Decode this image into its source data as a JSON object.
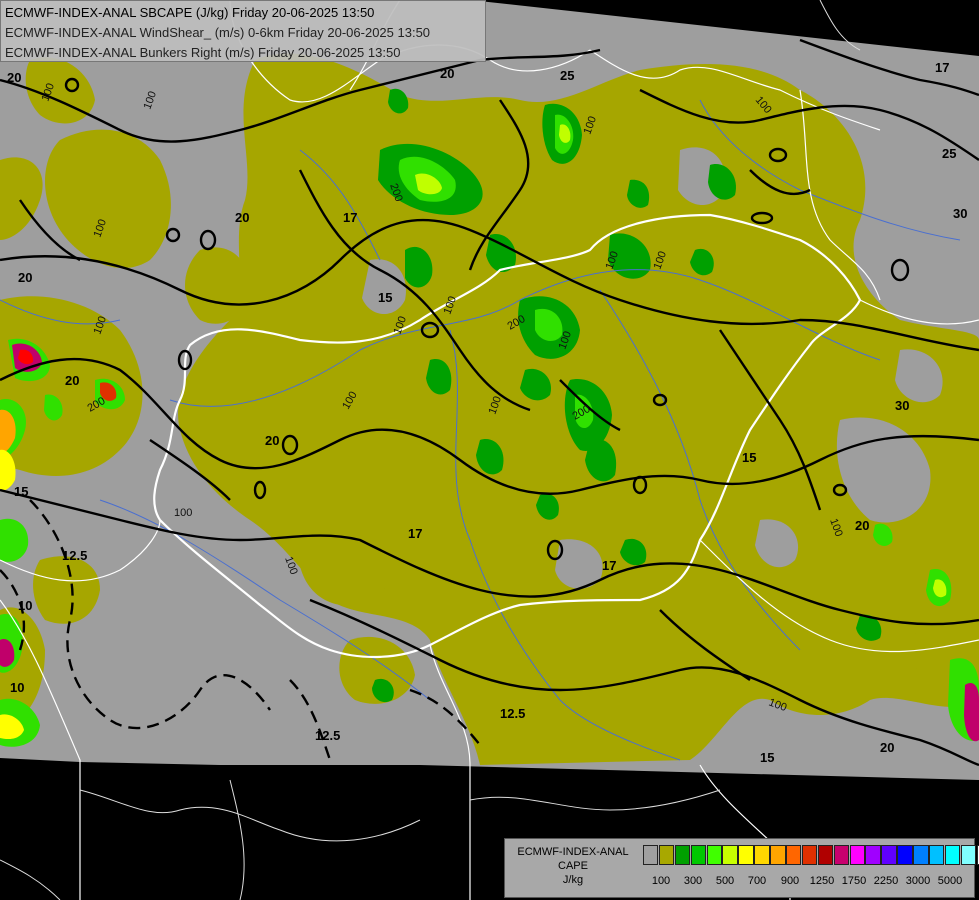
{
  "header": {
    "line1": "ECMWF-INDEX-ANAL SBCAPE (J/kg) Friday 20-06-2025 13:50",
    "line2": "ECMWF-INDEX-ANAL WindShear_ (m/s) 0-6km Friday 20-06-2025 13:50",
    "line3": "ECMWF-INDEX-ANAL Bunkers Right (m/s) Friday 20-06-2025 13:50"
  },
  "legend": {
    "title1": "ECMWF-INDEX-ANAL",
    "title2": "CAPE",
    "title3": "J/kg",
    "colors": [
      "#a0a0a0",
      "#a8a800",
      "#00a000",
      "#00c800",
      "#40ff00",
      "#c8ff00",
      "#ffff00",
      "#ffd700",
      "#ffa500",
      "#ff6600",
      "#e03000",
      "#b00000",
      "#c8006e",
      "#ff00ff",
      "#a000ff",
      "#6000ff",
      "#0000ff",
      "#0080ff",
      "#00c0ff",
      "#00ffff",
      "#80ffff",
      "#ffffff"
    ],
    "ticks": [
      "100",
      "300",
      "500",
      "700",
      "900",
      "1250",
      "1750",
      "2250",
      "3000",
      "5000"
    ]
  },
  "map": {
    "colors": {
      "background": "#000000",
      "no_cape": "#9e9e9e",
      "cape_100": "#a6a600",
      "cape_300": "#00a000",
      "cape_500": "#30e000",
      "cape_high": "#c0ff00",
      "cape_vhigh": "#ff0000",
      "cape_ext": "#c0006a",
      "border": "#ffffff",
      "river": "#4a6fd0",
      "contour": "#000000"
    },
    "contour_labels": [
      "20",
      "25",
      "17",
      "25",
      "30",
      "20",
      "17",
      "15",
      "20",
      "20",
      "15",
      "20",
      "12.5",
      "10",
      "10",
      "12.5",
      "12.5",
      "15",
      "20",
      "15",
      "17",
      "20",
      "30",
      "20",
      "17"
    ],
    "cape_labels": [
      "100",
      "100",
      "100",
      "100",
      "100",
      "100",
      "100",
      "100",
      "200",
      "200",
      "200",
      "200",
      "100",
      "100",
      "100",
      "100",
      "100",
      "100",
      "100",
      "100",
      "100"
    ]
  }
}
